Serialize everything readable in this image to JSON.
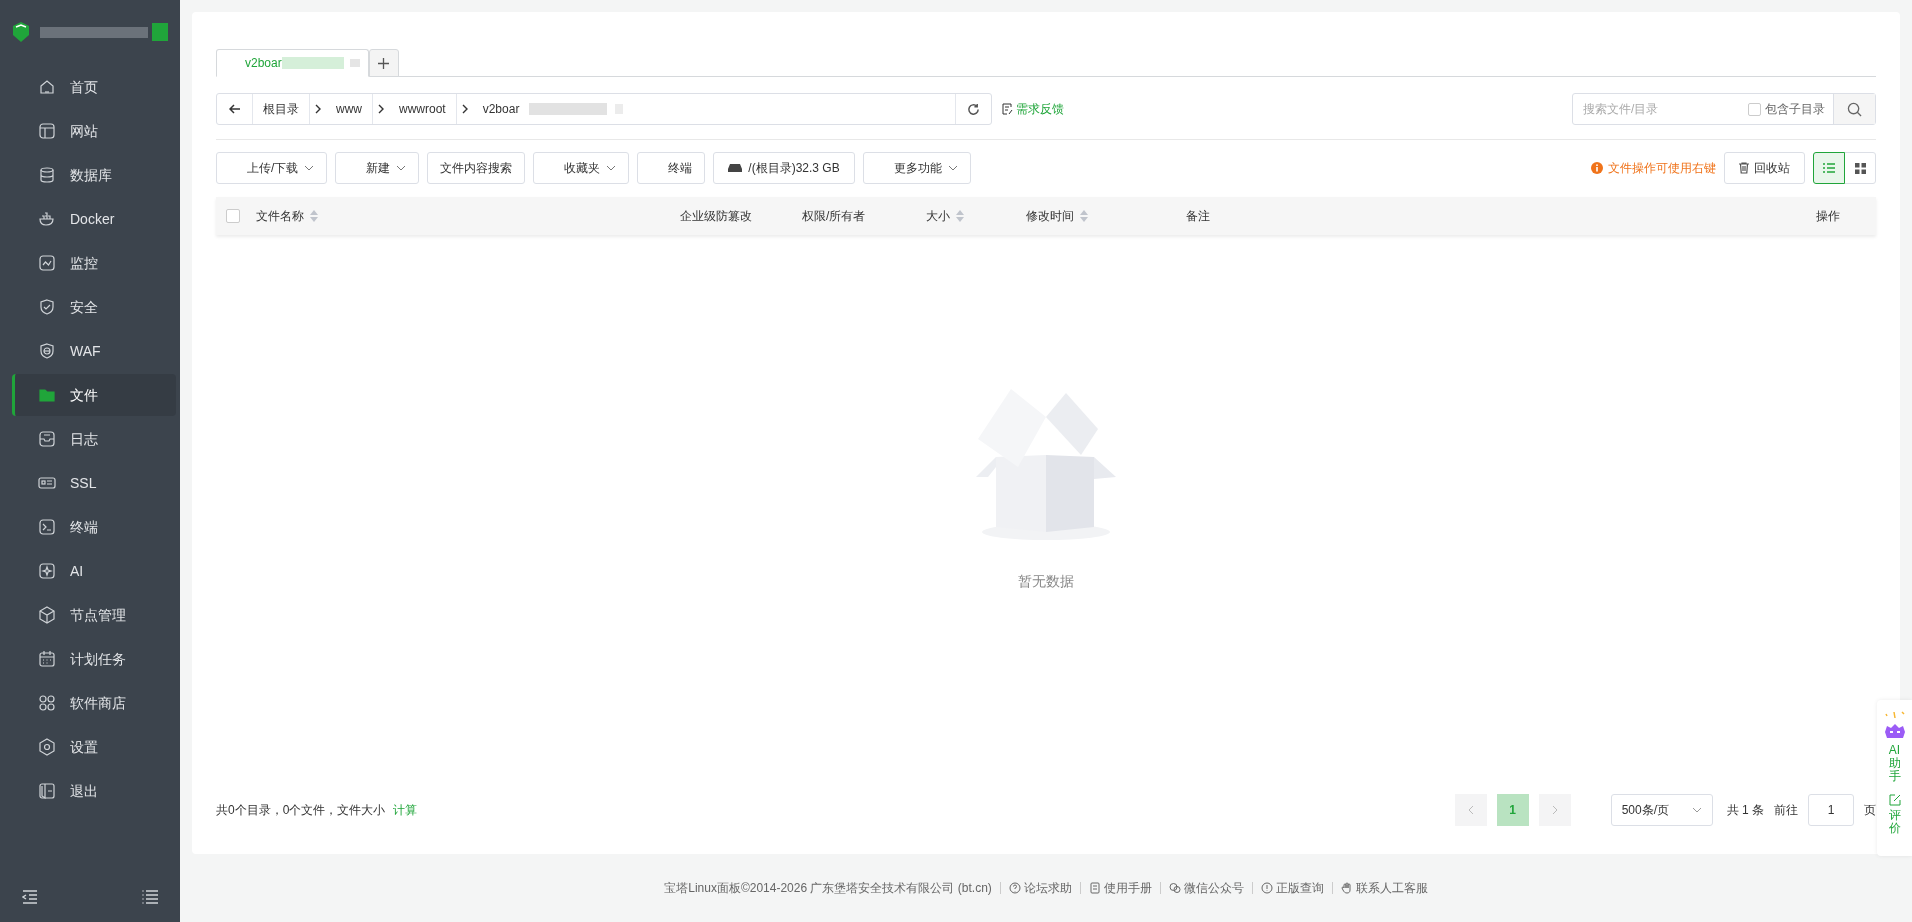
{
  "sidebar": {
    "items": [
      {
        "label": "首页",
        "selected": false
      },
      {
        "label": "网站",
        "selected": false
      },
      {
        "label": "数据库",
        "selected": false
      },
      {
        "label": "Docker",
        "selected": false
      },
      {
        "label": "监控",
        "selected": false
      },
      {
        "label": "安全",
        "selected": false
      },
      {
        "label": "WAF",
        "selected": false
      },
      {
        "label": "文件",
        "selected": true
      },
      {
        "label": "日志",
        "selected": false
      },
      {
        "label": "SSL",
        "selected": false
      },
      {
        "label": "终端",
        "selected": false
      },
      {
        "label": "AI",
        "selected": false
      },
      {
        "label": "节点管理",
        "selected": false
      },
      {
        "label": "计划任务",
        "selected": false
      },
      {
        "label": "软件商店",
        "selected": false
      },
      {
        "label": "设置",
        "selected": false
      },
      {
        "label": "退出",
        "selected": false
      }
    ]
  },
  "tabs": [
    {
      "label": "v2boar",
      "selected": true
    }
  ],
  "breadcrumb": [
    "根目录",
    "www",
    "wwwroot",
    "v2boar"
  ],
  "feedback_link": "需求反馈",
  "search": {
    "placeholder": "搜索文件/目录",
    "include_subdirs_label": "包含子目录",
    "include_subdirs": false
  },
  "toolbar": [
    {
      "label": "上传/下载",
      "dropdown": true,
      "kind": "button"
    },
    {
      "label": "新建",
      "dropdown": true,
      "kind": "button"
    },
    {
      "label": "文件内容搜索",
      "dropdown": false,
      "kind": "button"
    },
    {
      "label": "收藏夹",
      "dropdown": true,
      "kind": "button"
    },
    {
      "label": "终端",
      "dropdown": false,
      "kind": "button"
    },
    {
      "label": "/(根目录)32.3 GB",
      "dropdown": false,
      "kind": "disk"
    },
    {
      "label": "更多功能",
      "dropdown": true,
      "kind": "button"
    }
  ],
  "hint": "文件操作可使用右键",
  "recycle_bin": "回收站",
  "view_mode": [
    {
      "kind": "list",
      "selected": true
    },
    {
      "kind": "grid",
      "selected": false
    }
  ],
  "table": {
    "select_all": false,
    "columns": [
      {
        "label": "文件名称",
        "sortable": true
      },
      {
        "label": "企业级防篡改",
        "sortable": false
      },
      {
        "label": "权限/所有者",
        "sortable": false
      },
      {
        "label": "大小",
        "sortable": true
      },
      {
        "label": "修改时间",
        "sortable": true
      },
      {
        "label": "备注",
        "sortable": false
      },
      {
        "label": "操作",
        "sortable": false
      }
    ],
    "empty_text": "暂无数据"
  },
  "summary": {
    "text": "共0个目录，0个文件，文件大小",
    "link": "计算"
  },
  "pagination": {
    "pages": [
      {
        "label": "1",
        "selected": true
      }
    ],
    "page_size": "500条/页",
    "total": "共 1 条",
    "goto_label": "前往",
    "goto_value": "1",
    "page_unit": "页"
  },
  "side_panel": {
    "ai_label": "AI助手",
    "review_label": "评价"
  },
  "footer": {
    "copyright": "宝塔Linux面板©2014-2026 广东堡塔安全技术有限公司 (bt.cn)",
    "links": [
      "论坛求助",
      "使用手册",
      "微信公众号",
      "正版查询",
      "联系人工客服"
    ]
  }
}
